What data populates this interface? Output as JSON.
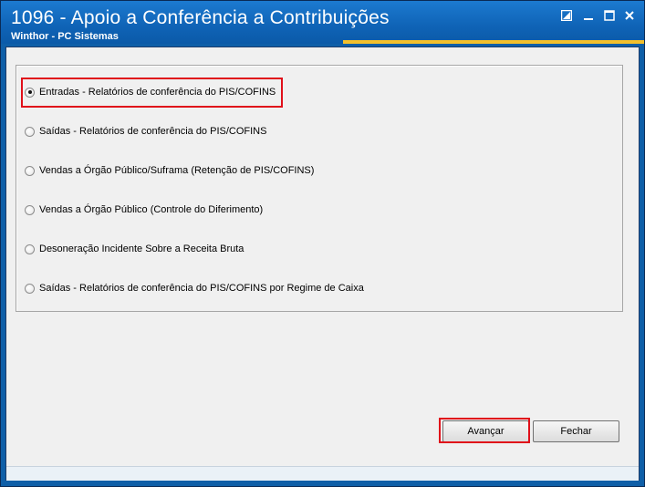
{
  "window": {
    "title": "1096 - Apoio a Conferência a Contribuições",
    "subtitle": "Winthor - PC Sistemas"
  },
  "options": [
    {
      "label": "Entradas - Relatórios de conferência do PIS/COFINS",
      "selected": true
    },
    {
      "label": "Saídas - Relatórios de conferência do PIS/COFINS",
      "selected": false
    },
    {
      "label": "Vendas a Órgão Público/Suframa (Retenção de PIS/COFINS)",
      "selected": false
    },
    {
      "label": "Vendas a Órgão Público (Controle do Diferimento)",
      "selected": false
    },
    {
      "label": "Desoneração Incidente Sobre a Receita Bruta",
      "selected": false
    },
    {
      "label": "Saídas - Relatórios de conferência do PIS/COFINS por Regime de Caixa",
      "selected": false
    }
  ],
  "buttons": {
    "next_label": "Avançar",
    "close_label": "Fechar"
  },
  "colors": {
    "titlebar": "#0f63b6",
    "accent": "#f3c02c",
    "highlight": "#e0101a"
  }
}
